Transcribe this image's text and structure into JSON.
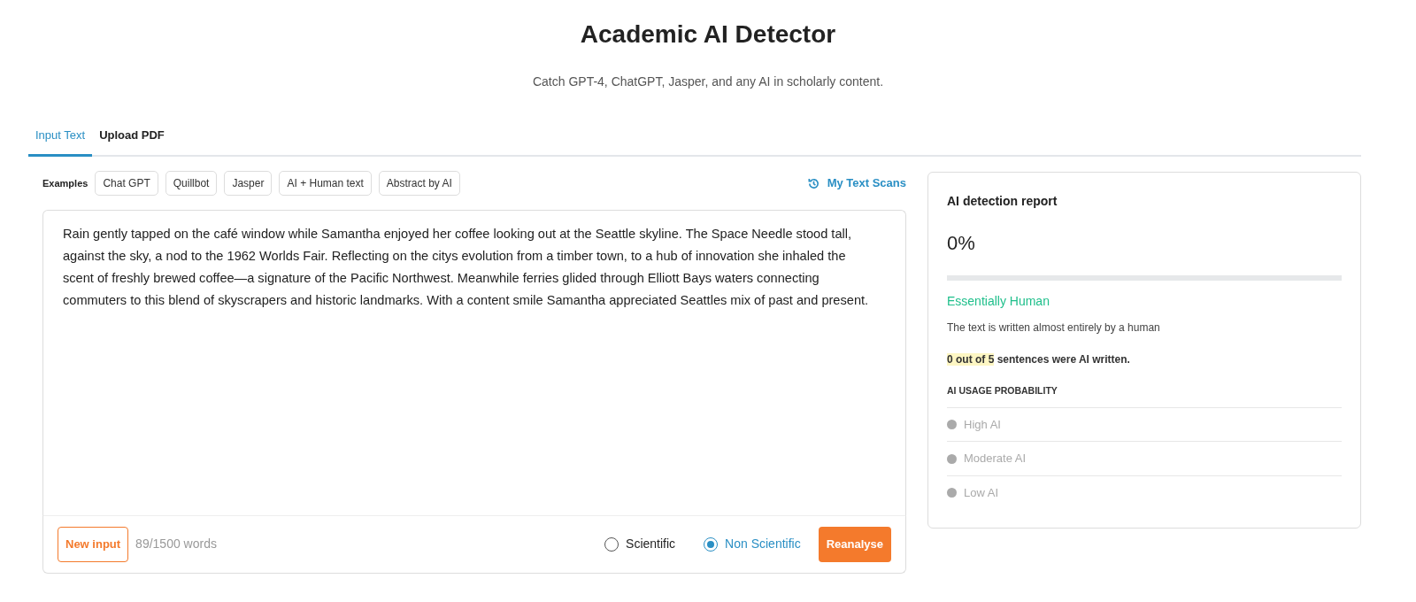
{
  "header": {
    "title": "Academic AI Detector",
    "subtitle": "Catch GPT-4, ChatGPT, Jasper, and any AI in scholarly content."
  },
  "tabs": [
    {
      "label": "Input Text",
      "selected": true
    },
    {
      "label": "Upload PDF",
      "selected": false
    }
  ],
  "examples": {
    "label": "Examples",
    "items": [
      "Chat GPT",
      "Quillbot",
      "Jasper",
      "AI + Human text",
      "Abstract by AI"
    ]
  },
  "scans_link": "My Text Scans",
  "input_text": "Rain gently tapped on the café window while Samantha enjoyed her coffee looking out at the Seattle skyline. The Space Needle stood tall, against the sky, a nod to the 1962 Worlds Fair. Reflecting on the citys evolution from a timber town, to a hub of innovation she inhaled the scent of freshly brewed coffee—a signature of the Pacific Northwest. Meanwhile ferries glided through Elliott Bays waters connecting commuters to this blend of skyscrapers and historic landmarks. With a content smile Samantha appreciated Seattles mix of past and present.",
  "footer": {
    "new_input": "New input",
    "word_count": "89/1500 words",
    "modes": [
      {
        "label": "Scientific",
        "selected": false
      },
      {
        "label": "Non Scientific",
        "selected": true
      }
    ],
    "action": "Reanalyse"
  },
  "report": {
    "title": "AI detection report",
    "percent": "0%",
    "level": 0,
    "verdict": "Essentially Human",
    "description": "The text is written almost entirely by a human",
    "summary_highlight": "0 out of 5",
    "summary_rest": "sentences were AI written.",
    "probability_heading": "AI USAGE PROBABILITY",
    "probability_levels": [
      "High AI",
      "Moderate AI",
      "Low AI"
    ]
  }
}
